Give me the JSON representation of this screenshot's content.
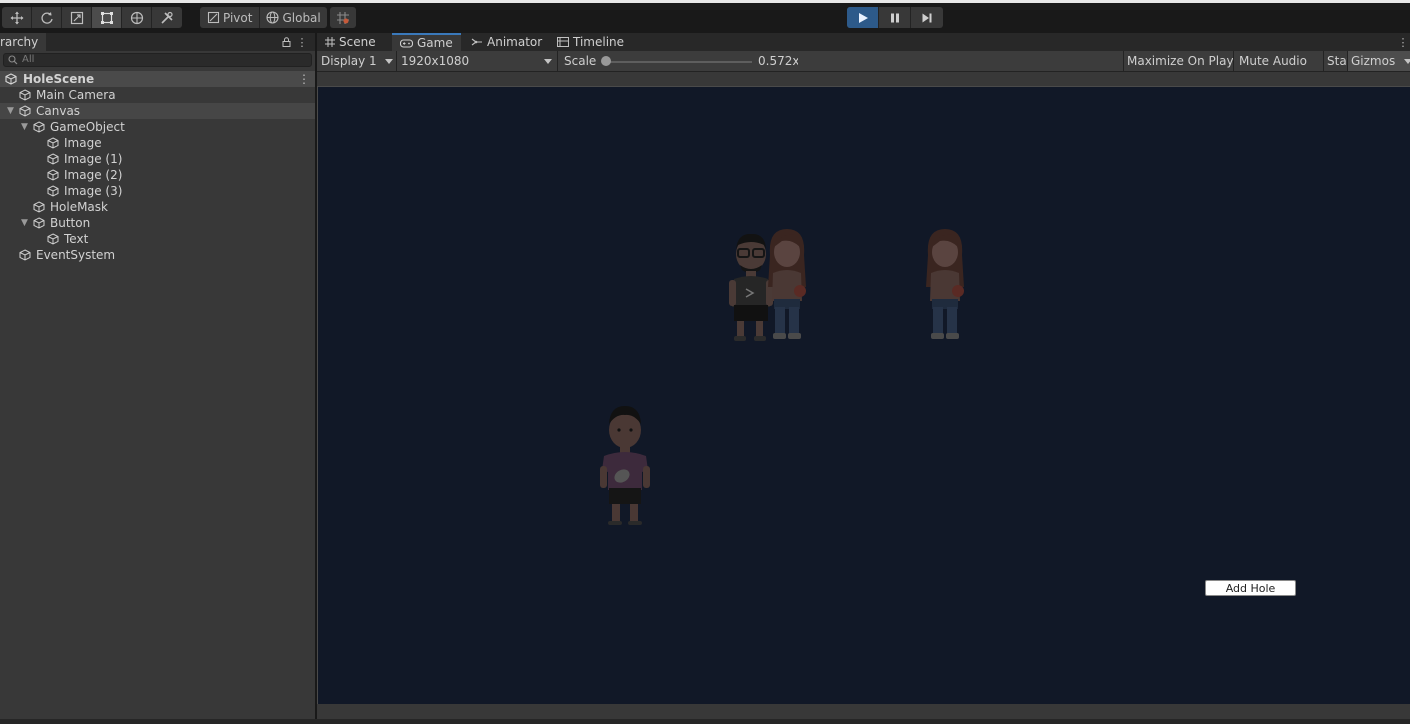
{
  "toolbar": {
    "tools": [
      {
        "name": "move-tool-icon"
      },
      {
        "name": "rotate-tool-icon"
      },
      {
        "name": "scale-tool-icon"
      },
      {
        "name": "rect-tool-icon",
        "active": true
      },
      {
        "name": "transform-tool-icon"
      },
      {
        "name": "custom-tool-icon"
      }
    ],
    "pivot_label": "Pivot",
    "global_label": "Global",
    "playback": {
      "play_active": true
    }
  },
  "hierarchy": {
    "tab_label": "rarchy",
    "search_placeholder": "All",
    "scene_name": "HoleScene",
    "items": [
      {
        "label": "Main Camera",
        "depth": 0,
        "foldable": false
      },
      {
        "label": "Canvas",
        "depth": 0,
        "foldable": true,
        "selected": true
      },
      {
        "label": "GameObject",
        "depth": 1,
        "foldable": true
      },
      {
        "label": "Image",
        "depth": 2,
        "foldable": false
      },
      {
        "label": "Image (1)",
        "depth": 2,
        "foldable": false
      },
      {
        "label": "Image (2)",
        "depth": 2,
        "foldable": false
      },
      {
        "label": "Image (3)",
        "depth": 2,
        "foldable": false
      },
      {
        "label": "HoleMask",
        "depth": 1,
        "foldable": false
      },
      {
        "label": "Button",
        "depth": 1,
        "foldable": true
      },
      {
        "label": "Text",
        "depth": 2,
        "foldable": false
      },
      {
        "label": "EventSystem",
        "depth": 0,
        "foldable": false
      }
    ]
  },
  "game_view": {
    "tabs": [
      {
        "label": "Scene",
        "icon": "grid-icon"
      },
      {
        "label": "Game",
        "icon": "gamepad-icon",
        "active": true
      },
      {
        "label": "Animator",
        "icon": "animator-icon"
      },
      {
        "label": "Timeline",
        "icon": "timeline-icon"
      }
    ],
    "display_label": "Display 1",
    "resolution_label": "1920x1080",
    "scale_label": "Scale",
    "scale_value": "0.572x",
    "scale_level": 0.0,
    "maximize_label": "Maximize On Play",
    "mute_label": "Mute Audio",
    "stats_label": "Stats",
    "gizmos_label": "Gizmos",
    "add_hole_label": "Add Hole",
    "background_color": "#111827"
  }
}
